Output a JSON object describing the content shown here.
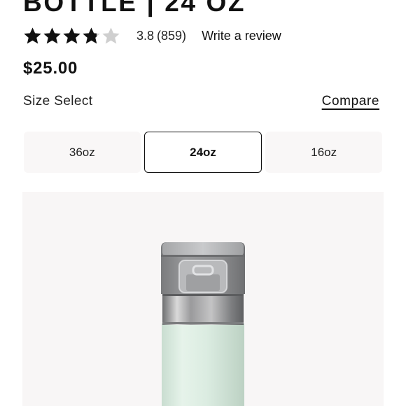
{
  "product": {
    "title": "BOTTLE | 24 OZ",
    "rating_value": "3.8",
    "rating_count": "(859)",
    "rating_stars": 3.8,
    "write_review": "Write a review",
    "price": "$25.00"
  },
  "size_select": {
    "label": "Size Select",
    "compare": "Compare",
    "options": [
      {
        "label": "36oz",
        "selected": false
      },
      {
        "label": "24oz",
        "selected": true
      },
      {
        "label": "16oz",
        "selected": false
      }
    ]
  },
  "colors": {
    "star_filled": "#111111",
    "star_empty": "#cfcfcf",
    "selected_border": "#111111",
    "option_background": "#f9f7f7",
    "image_background": "#f8f6f6",
    "bottle_body": "#dbece1",
    "bottle_lid": "#8a8b8d"
  }
}
